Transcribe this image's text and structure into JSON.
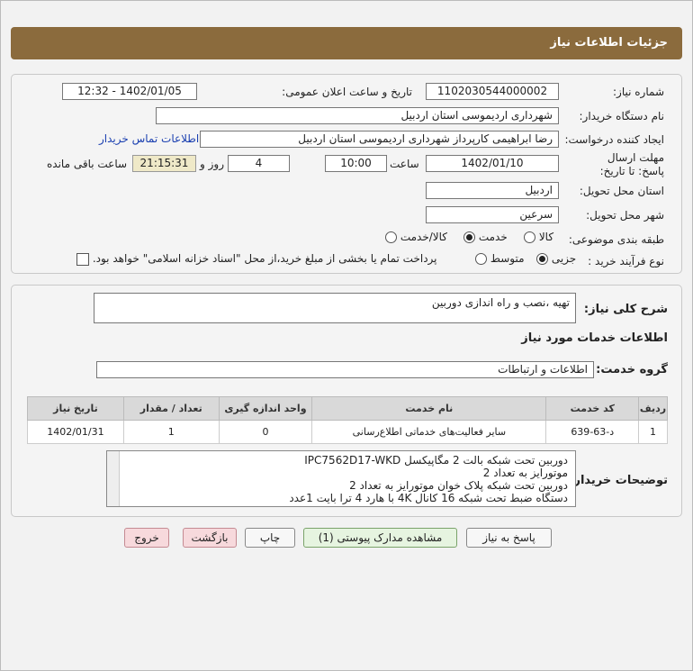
{
  "header": {
    "title": "جزئیات اطلاعات نیاز"
  },
  "fields": {
    "need_number_label": "شماره نیاز:",
    "need_number": "1102030544000002",
    "announce_label": "تاریخ و ساعت اعلان عمومی:",
    "announce_value": "1402/01/05 - 12:32",
    "buyer_label": "نام دستگاه خریدار:",
    "buyer_value": "شهرداری اردیموسی استان اردبیل",
    "creator_label": "ایجاد کننده درخواست:",
    "creator_value": "رضا ابراهیمی کارپرداز شهرداری اردیموسی استان اردبیل",
    "contact_link": "اطلاعات تماس خریدار",
    "deadline_label": "مهلت ارسال پاسخ: تا تاریخ:",
    "deadline_date": "1402/01/10",
    "time_label": "ساعت",
    "deadline_time": "10:00",
    "days_value": "4",
    "days_label": "روز و",
    "remaining_time": "21:15:31",
    "remaining_label": "ساعت باقی مانده",
    "province_label": "استان محل تحویل:",
    "province_value": "اردبیل",
    "city_label": "شهر محل تحویل:",
    "city_value": "سرعین",
    "category_label": "طبقه بندی موضوعی:",
    "category_options": [
      "کالا",
      "خدمت",
      "کالا/خدمت"
    ],
    "category_selected": "خدمت",
    "process_label": "نوع فرآیند خرید :",
    "process_options": [
      "جزیی",
      "متوسط"
    ],
    "process_selected": "جزیی",
    "payment_note": "پرداخت تمام یا بخشی از مبلغ خرید،از محل \"اسناد خزانه اسلامی\" خواهد بود."
  },
  "summary": {
    "label": "شرح کلی نیاز:",
    "value": "تهیه ،نصب و راه اندازی دوربین",
    "services_title": "اطلاعات خدمات مورد نیاز",
    "group_label": "گروه خدمت:",
    "group_value": "اطلاعات و ارتباطات"
  },
  "table": {
    "headers": [
      "ردیف",
      "کد خدمت",
      "نام خدمت",
      "واحد اندازه گیری",
      "تعداد / مقدار",
      "تاریخ نیاز"
    ],
    "rows": [
      [
        "1",
        "د-63-639",
        "سایر فعالیت‌های خدماتی اطلاع‌رسانی",
        "0",
        "1",
        "1402/01/31"
      ]
    ]
  },
  "buyer_notes": {
    "label": "توضیحات خریدار:",
    "lines": [
      "دوربین تحت شبکه بالت 2 مگاپیکسل IPC7562D17-WKD",
      "موتورایز  به تعداد 2",
      "دوربین تحت شبکه پلاک خوان موتورایز به تعداد 2",
      "دستگاه ضبط تحت شبکه 16 کانال 4K با هارد 4 ترا بایت  1عدد"
    ]
  },
  "buttons": {
    "reply": "پاسخ به نیاز",
    "docs": "مشاهده مدارک پیوستی (1)",
    "print": "چاپ",
    "back": "بازگشت",
    "exit": "خروج"
  },
  "colors": {
    "titlebar": "#8b6b3d",
    "remaining_bg": "#efe9c8",
    "link": "#1a3fb0"
  }
}
